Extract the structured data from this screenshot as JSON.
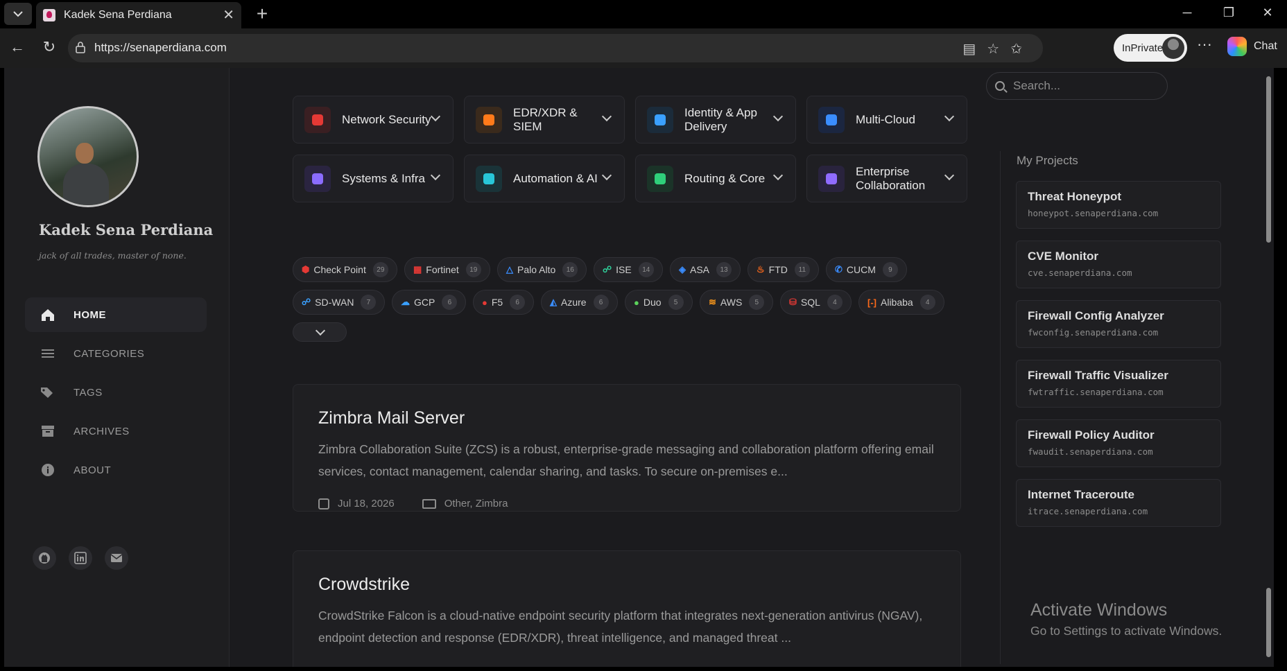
{
  "browser": {
    "tab_title": "Kadek Sena Perdiana",
    "url": "https://senaperdiana.com",
    "inprivate_label": "InPrivate",
    "chat_label": "Chat"
  },
  "sidebar": {
    "site_title": "Kadek Sena Perdiana",
    "tagline": "jack of all trades, master of none.",
    "nav": [
      {
        "label": "HOME",
        "icon": "home-icon"
      },
      {
        "label": "CATEGORIES",
        "icon": "list-icon"
      },
      {
        "label": "TAGS",
        "icon": "tags-icon"
      },
      {
        "label": "ARCHIVES",
        "icon": "archive-icon"
      },
      {
        "label": "ABOUT",
        "icon": "info-icon"
      }
    ],
    "social": [
      "github-icon",
      "linkedin-icon",
      "email-icon"
    ]
  },
  "categories": [
    {
      "label": "Network Security",
      "color": "#e53935",
      "bg": "#3a1f22",
      "icon": "shield-icon"
    },
    {
      "label": "EDR/XDR & SIEM",
      "color": "#ff7a1a",
      "bg": "#3a2a1c",
      "icon": "crosshair-icon"
    },
    {
      "label": "Identity & App Delivery",
      "color": "#3aa0ff",
      "bg": "#1b2b3a",
      "icon": "network-icon"
    },
    {
      "label": "Multi-Cloud",
      "color": "#3a8dff",
      "bg": "#1b2640",
      "icon": "cloud-icon"
    },
    {
      "label": "Systems & Infra",
      "color": "#8b6cff",
      "bg": "#2a2440",
      "icon": "server-icon"
    },
    {
      "label": "Automation & AI",
      "color": "#28c6d8",
      "bg": "#1a3338",
      "icon": "gears-icon"
    },
    {
      "label": "Routing & Core",
      "color": "#2fcf7a",
      "bg": "#1b3328",
      "icon": "route-icon"
    },
    {
      "label": "Enterprise Collaboration",
      "color": "#8f6bff",
      "bg": "#29233d",
      "icon": "headset-icon"
    }
  ],
  "tags": [
    {
      "label": "Check Point",
      "count": "29",
      "color": "#e53935",
      "glyph": "⬢"
    },
    {
      "label": "Fortinet",
      "count": "19",
      "color": "#e53935",
      "glyph": "▦"
    },
    {
      "label": "Palo Alto",
      "count": "16",
      "color": "#3a8dff",
      "glyph": "△"
    },
    {
      "label": "ISE",
      "count": "14",
      "color": "#2fcf9a",
      "glyph": "☍"
    },
    {
      "label": "ASA",
      "count": "13",
      "color": "#3a8dff",
      "glyph": "◈"
    },
    {
      "label": "FTD",
      "count": "11",
      "color": "#ff6a1a",
      "glyph": "♨"
    },
    {
      "label": "CUCM",
      "count": "9",
      "color": "#3a8dff",
      "glyph": "✆"
    },
    {
      "label": "SD-WAN",
      "count": "7",
      "color": "#3aa0ff",
      "glyph": "☍"
    },
    {
      "label": "GCP",
      "count": "6",
      "color": "#3aa0ff",
      "glyph": "☁"
    },
    {
      "label": "F5",
      "count": "6",
      "color": "#e53935",
      "glyph": "●"
    },
    {
      "label": "Azure",
      "count": "6",
      "color": "#3a8dff",
      "glyph": "◭"
    },
    {
      "label": "Duo",
      "count": "5",
      "color": "#5bd25b",
      "glyph": "●"
    },
    {
      "label": "AWS",
      "count": "5",
      "color": "#ff9a1a",
      "glyph": "≋"
    },
    {
      "label": "SQL",
      "count": "4",
      "color": "#e53935",
      "glyph": "⛁"
    },
    {
      "label": "Alibaba",
      "count": "4",
      "color": "#ff6a1a",
      "glyph": "[-]"
    }
  ],
  "posts": [
    {
      "title": "Zimbra Mail Server",
      "description": "Zimbra Collaboration Suite (ZCS) is a robust, enterprise-grade messaging and collaboration platform offering email services, contact management, calendar sharing, and tasks. To secure on-premises e...",
      "date": "Jul 18, 2026",
      "categories": "Other, Zimbra"
    },
    {
      "title": "Crowdstrike",
      "description": "CrowdStrike Falcon is a cloud-native endpoint security platform that integrates next-generation antivirus (NGAV), endpoint detection and response (EDR/XDR), threat intelligence, and managed threat ...",
      "date": "",
      "categories": ""
    }
  ],
  "right": {
    "search_placeholder": "Search...",
    "projects_heading": "My Projects",
    "projects": [
      {
        "name": "Threat Honeypot",
        "url": "honeypot.senaperdiana.com"
      },
      {
        "name": "CVE Monitor",
        "url": "cve.senaperdiana.com"
      },
      {
        "name": "Firewall Config Analyzer",
        "url": "fwconfig.senaperdiana.com"
      },
      {
        "name": "Firewall Traffic Visualizer",
        "url": "fwtraffic.senaperdiana.com"
      },
      {
        "name": "Firewall Policy Auditor",
        "url": "fwaudit.senaperdiana.com"
      },
      {
        "name": "Internet Traceroute",
        "url": "itrace.senaperdiana.com"
      }
    ],
    "activate_title": "Activate Windows",
    "activate_sub": "Go to Settings to activate Windows."
  }
}
